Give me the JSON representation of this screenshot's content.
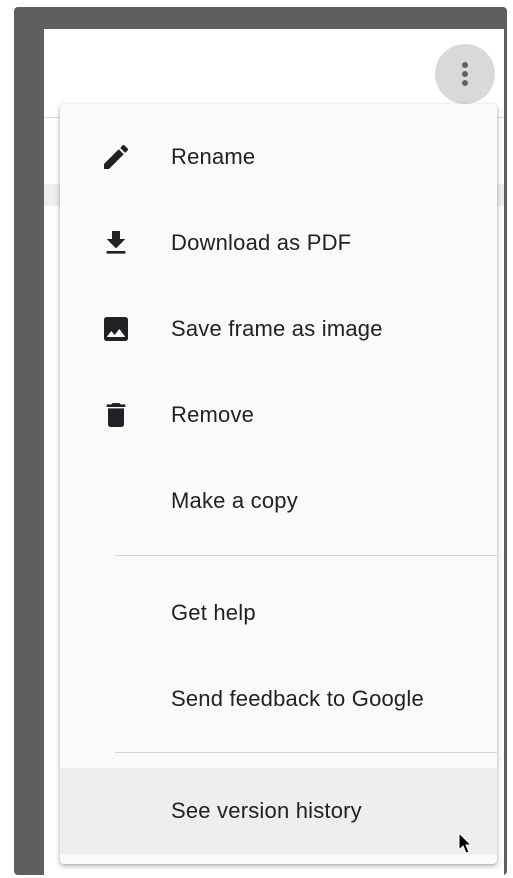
{
  "menu": {
    "items": [
      {
        "label": "Rename",
        "icon": "pencil-icon"
      },
      {
        "label": "Download as PDF",
        "icon": "download-icon"
      },
      {
        "label": "Save frame as image",
        "icon": "image-icon"
      },
      {
        "label": "Remove",
        "icon": "trash-icon"
      },
      {
        "label": "Make a copy",
        "icon": ""
      },
      {
        "label": "Get help",
        "icon": ""
      },
      {
        "label": "Send feedback to Google",
        "icon": ""
      },
      {
        "label": "See version history",
        "icon": ""
      }
    ]
  },
  "colors": {
    "frame": "#5f5f5f",
    "menu_background": "#fafafa",
    "hover_background": "#eeeeee",
    "text": "#202124",
    "icon": "#202124"
  },
  "hovered_item": "See version history"
}
